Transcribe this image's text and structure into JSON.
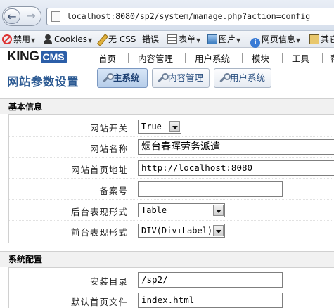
{
  "browser": {
    "url": "localhost:8080/sp2/system/manage.php?action=config",
    "toolbar": [
      {
        "label": "禁用",
        "icon": "no-entry-icon"
      },
      {
        "label": "Cookies",
        "icon": "person-icon"
      },
      {
        "label": "无 CSS",
        "icon": "pencil-icon"
      },
      {
        "label": "错误",
        "icon": "css-icon"
      },
      {
        "label": "表单",
        "icon": "form-icon"
      },
      {
        "label": "图片",
        "icon": "image-icon"
      },
      {
        "label": "网页信息",
        "icon": "info-icon"
      },
      {
        "label": "其它",
        "icon": "other-icon"
      }
    ]
  },
  "header": {
    "logo_king": "KING",
    "logo_cms": "CMS",
    "nav": [
      "首页",
      "内容管理",
      "用户系统",
      "模块",
      "工具",
      "帮"
    ]
  },
  "page": {
    "title": "网站参数设置",
    "tabs": [
      {
        "label": "主系统",
        "active": true
      },
      {
        "label": "内容管理",
        "active": false
      },
      {
        "label": "用户系统",
        "active": false
      }
    ]
  },
  "sections": [
    {
      "title": "基本信息",
      "rows": [
        {
          "label": "网站开关",
          "type": "select",
          "value": "True"
        },
        {
          "label": "网站名称",
          "type": "input",
          "value": "烟台春晖劳务派遣"
        },
        {
          "label": "网站首页地址",
          "type": "input",
          "value": "http://localhost:8080"
        },
        {
          "label": "备案号",
          "type": "input",
          "value": ""
        },
        {
          "label": "后台表现形式",
          "type": "select",
          "value": "Table"
        },
        {
          "label": "前台表现形式",
          "type": "select",
          "value": "DIV(Div+Label)"
        }
      ]
    },
    {
      "title": "系统配置",
      "rows": [
        {
          "label": "安装目录",
          "type": "input",
          "value": "/sp2/"
        },
        {
          "label": "默认首页文件",
          "type": "input",
          "value": "index.html"
        }
      ]
    }
  ],
  "colors": {
    "accent": "#2c5a93",
    "logo_cms_bg": "#2b5ea8"
  }
}
